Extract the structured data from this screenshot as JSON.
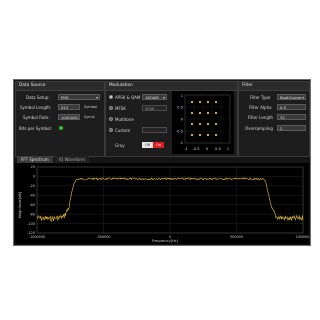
{
  "data_source": {
    "title": "Data Source",
    "data_setup_label": "Data Setup:",
    "data_setup_value": "PN9",
    "symbol_length_label": "Symbol Length:",
    "symbol_length_value": "512",
    "symbol_length_unit": "Symbol",
    "symbol_rate_label": "Symbol Rate:",
    "symbol_rate_value": "1000000",
    "symbol_rate_unit": "Sym/s",
    "bits_per_symbol_label": "Bits per Symbol:"
  },
  "modulation": {
    "title": "Modulation",
    "apsk_label": "APSK & QAM",
    "apsk_value": "16QAM",
    "mfsk_label": "MFSK",
    "mfsk_value": "2FSK",
    "multitone_label": "Multitone",
    "custom_label": "Custom",
    "gray_label": "Gray",
    "gray_off": "Off",
    "gray_on": "On",
    "constellation_ticks_x": [
      "-1",
      "-0.5",
      "0",
      "0.5",
      "1"
    ],
    "constellation_ticks_y": [
      "1",
      "0.5",
      "0",
      "-0.5",
      "-1"
    ]
  },
  "filter": {
    "title": "Filter",
    "filter_type_label": "Filter Type",
    "filter_type_value": "RootCosine",
    "filter_alpha_label": "Filter Alpha",
    "filter_alpha_value": "0.5",
    "filter_length_label": "Filter Length",
    "filter_length_value": "32",
    "oversampling_label": "Oversampling",
    "oversampling_value": "2"
  },
  "tabs": [
    "FFT Spectrum",
    "IQ Waveform"
  ],
  "chart_data": {
    "type": "line",
    "xlabel": "Frequency[Hz]",
    "ylabel": "Magnitude[dB]",
    "x_ticks": [
      "-1000000",
      "-500000",
      "0",
      "500000",
      "1000000"
    ],
    "y_ticks": [
      "20",
      "0",
      "-20",
      "-40",
      "-60",
      "-80",
      "-100",
      "-120"
    ],
    "xlim": [
      -1000000,
      1000000
    ],
    "ylim": [
      -120,
      20
    ],
    "series": [
      {
        "x": [
          -1000000,
          -900000,
          -800000,
          -760000,
          -740000,
          -720000,
          -700000,
          -600000,
          -400000,
          -200000,
          0,
          200000,
          400000,
          600000,
          700000,
          720000,
          740000,
          760000,
          800000,
          900000,
          1000000
        ],
        "values": [
          -82,
          -84,
          -80,
          -60,
          -35,
          -10,
          -4,
          -3,
          -3,
          -3,
          -3,
          -3,
          -3,
          -3,
          -4,
          -10,
          -35,
          -60,
          -80,
          -84,
          -82
        ]
      }
    ],
    "color": "#e8c03a",
    "background": "#000000",
    "grid": true
  }
}
